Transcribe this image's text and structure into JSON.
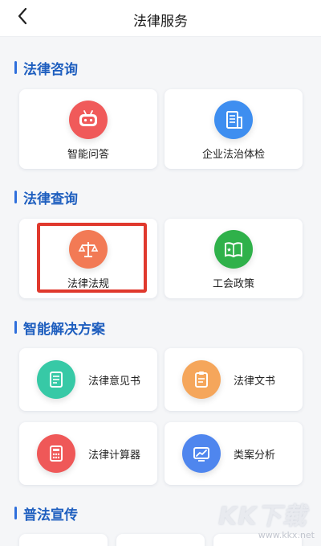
{
  "header": {
    "title": "法律服务",
    "back_icon": "chevron-left-icon"
  },
  "sections": [
    {
      "title": "法律咨询",
      "items": [
        {
          "label": "智能问答",
          "icon": "robot-icon",
          "color": "#f05a5a"
        },
        {
          "label": "企业法治体检",
          "icon": "building-icon",
          "color": "#3e8ef0"
        }
      ]
    },
    {
      "title": "法律查询",
      "items": [
        {
          "label": "法律法规",
          "icon": "scales-icon",
          "color": "#f27a55"
        },
        {
          "label": "工会政策",
          "icon": "book-icon",
          "color": "#2fb14a"
        }
      ]
    },
    {
      "title": "智能解决方案",
      "items": [
        {
          "label": "法律意见书",
          "icon": "document-icon",
          "color": "#37c9a6"
        },
        {
          "label": "法律文书",
          "icon": "clipboard-icon",
          "color": "#f5a65b"
        },
        {
          "label": "法律计算器",
          "icon": "calculator-icon",
          "color": "#ef5858"
        },
        {
          "label": "类案分析",
          "icon": "chart-icon",
          "color": "#4f86ee"
        }
      ]
    },
    {
      "title": "普法宣传",
      "items": []
    }
  ],
  "highlight_color": "#e0392d",
  "watermark": {
    "logo": "KK下载",
    "url": "www.kkx.net"
  }
}
